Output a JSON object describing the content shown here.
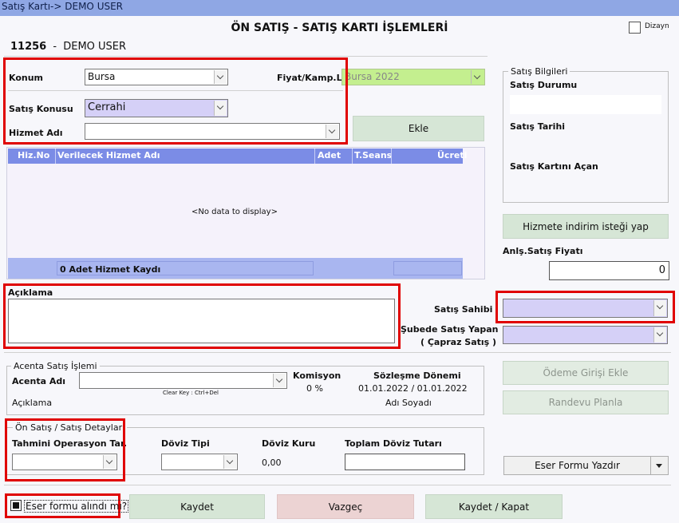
{
  "window": {
    "title": "Satış Kartı-> DEMO USER"
  },
  "page": {
    "title": "ÖN SATIŞ - SATIŞ KARTI İŞLEMLERİ",
    "customer_no": "11256",
    "customer_sep": "-",
    "customer_name": "DEMO USER",
    "dizayn_label": "Dizayn"
  },
  "form": {
    "konum_label": "Konum",
    "konum_value": "Bursa",
    "fiyat_label": "Fiyat/Kamp.Lis",
    "fiyat_value": "Bursa 2022",
    "satis_konusu_label": "Satış Konusu",
    "satis_konusu_value": "Cerrahi",
    "hizmet_adi_label": "Hizmet Adı",
    "hizmet_adi_value": "",
    "ekle_label": "Ekle"
  },
  "grid": {
    "columns": [
      "Hiz.No",
      "Verilecek Hizmet Adı",
      "Adet",
      "T.Seans",
      "Ücreti"
    ],
    "empty_text": "<No data to display>",
    "footer_count": "0 Adet Hizmet Kaydı"
  },
  "satis_bilgileri": {
    "legend": "Satış Bilgileri",
    "durum_label": "Satış Durumu",
    "durum_value": "",
    "tarih_label": "Satış Tarihi",
    "acan_label": "Satış Kartını Açan"
  },
  "indirim_label": "Hizmete indirim isteği yap",
  "anls_fiyat_label": "Anlş.Satış Fiyatı",
  "anls_fiyat_value": "0",
  "aciklama_label": "Açıklama",
  "satis_sahibi_label": "Satış Sahibi",
  "sube_label_1": "Şubede Satış Yapan",
  "sube_label_2": "( Çapraz Satış )",
  "acenta": {
    "legend": "Acenta Satış İşlemi",
    "adi_label": "Acenta Adı",
    "clear_hint": "Clear Key : Ctrl+Del",
    "komisyon_label": "Komisyon",
    "komisyon_value": "0 %",
    "sozlesme_label": "Sözleşme Dönemi",
    "sozlesme_value": "01.01.2022 / 01.01.2022",
    "aciklama_label": "Açıklama",
    "adi_soyadi_label": "Adı Soyadı"
  },
  "odeme_label": "Ödeme Girişi Ekle",
  "randevu_label": "Randevu Planla",
  "detay": {
    "legend": "Ön Satış / Satış Detayları",
    "tahmini_label": "Tahmini Operasyon Tar.",
    "doviz_tipi_label": "Döviz Tipi",
    "doviz_kuru_label": "Döviz Kuru",
    "doviz_kuru_value": "0,00",
    "toplam_label": "Toplam Döviz Tutarı"
  },
  "eser_yazdir_label": "Eser Formu Yazdır",
  "footer": {
    "eser_checkbox_label": "Eser formu alındı mı?",
    "kaydet": "Kaydet",
    "vazgec": "Vazgeç",
    "kaydet_kapat": "Kaydet / Kapat"
  },
  "colors": {
    "title_bar": "#8fa7e4",
    "grid_header": "#7b8ce6",
    "highlight": "#e00000",
    "lavender": "#d5d0f7",
    "lime": "#c4ef8f"
  }
}
